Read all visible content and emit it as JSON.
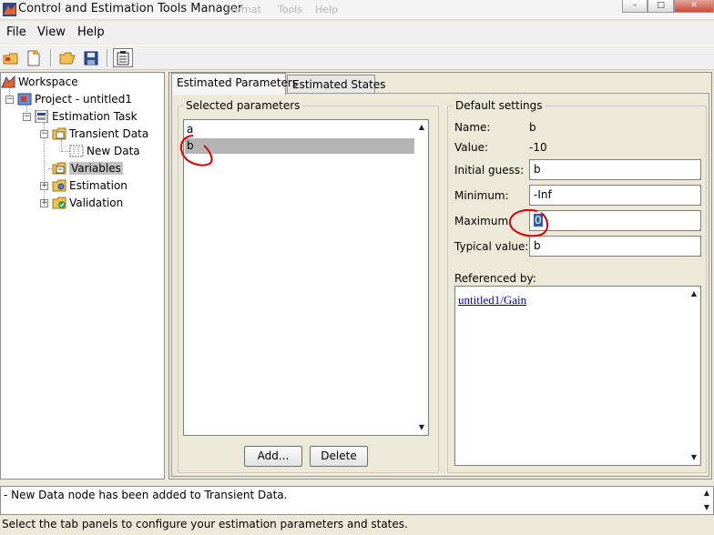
{
  "window": {
    "title": "Control and Estimation Tools Manager",
    "ghost_menus": [
      "Format",
      "Tools",
      "Help"
    ]
  },
  "menu": [
    "File",
    "View",
    "Help"
  ],
  "toolbar": {
    "icons": [
      "new-project-icon",
      "new-task-icon",
      "open-icon",
      "save-icon",
      "clipboard-icon"
    ]
  },
  "tree": {
    "items": [
      {
        "label": "Workspace",
        "icon": "workspace-icon"
      },
      {
        "label": "Project - untitled1",
        "icon": "project-icon"
      },
      {
        "label": "Estimation Task",
        "icon": "task-icon"
      },
      {
        "label": "Transient Data",
        "icon": "data-folder-icon"
      },
      {
        "label": "New Data",
        "icon": "data-icon"
      },
      {
        "label": "Variables",
        "icon": "variables-icon",
        "selected": true
      },
      {
        "label": "Estimation",
        "icon": "estimation-icon"
      },
      {
        "label": "Validation",
        "icon": "validation-icon"
      }
    ]
  },
  "tabs": [
    {
      "label": "Estimated Parameters",
      "active": true
    },
    {
      "label": "Estimated States",
      "active": false
    }
  ],
  "selected_parameters": {
    "title": "Selected parameters",
    "items": [
      {
        "label": "a",
        "selected": false
      },
      {
        "label": "b",
        "selected": true
      }
    ],
    "add_label": "Add...",
    "delete_label": "Delete"
  },
  "default_settings": {
    "title": "Default settings",
    "name_label": "Name:",
    "name_value": "b",
    "value_label": "Value:",
    "value_value": "-10",
    "initial_guess_label": "Initial guess:",
    "initial_guess_value": "b",
    "minimum_label": "Minimum:",
    "minimum_value": "-Inf",
    "maximum_label": "Maximum:",
    "maximum_value": "0",
    "typical_value_label": "Typical value:",
    "typical_value_value": "b",
    "referenced_by_label": "Referenced by:",
    "referenced_by_link": "untitled1/Gain"
  },
  "log": {
    "message": "- New Data node has been added to Transient Data."
  },
  "status": {
    "message": "Select the tab panels to configure your estimation parameters and states."
  },
  "colors": {
    "annotation": "#e00000",
    "selection": "#b4b4b4",
    "link": "#0000cc"
  }
}
